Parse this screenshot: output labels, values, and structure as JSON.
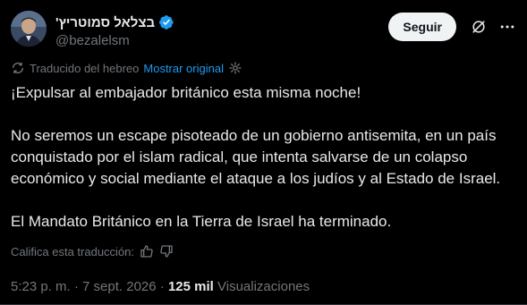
{
  "author": {
    "display_name": "בצלאל סמוטריץ'",
    "handle": "@bezalelsm",
    "verified": true
  },
  "actions": {
    "follow_label": "Seguir",
    "grok_icon": "grok-icon",
    "more_icon": "more-horizontal-icon"
  },
  "translation": {
    "note": "Traducido del hebreo",
    "show_original": "Mostrar original",
    "settings_icon": "gear-icon",
    "rate_label": "Califica esta traducción:"
  },
  "post": {
    "paragraphs": [
      "¡Expulsar al embajador británico esta misma noche!",
      "No seremos un escape pisoteado de un gobierno antisemita, en un país conquistado por el islam radical, que intenta salvarse de un colapso económico y social mediante el ataque a los judíos y al Estado de Israel.",
      "El Mandato Británico en la Tierra de Israel ha terminado."
    ]
  },
  "meta": {
    "time": "5:23 p. m.",
    "separator": "·",
    "date": "7 sept. 2026",
    "views_count": "125 mil",
    "views_label": "Visualizaciones"
  },
  "colors": {
    "background": "#000000",
    "text_primary": "#e7e9ea",
    "text_secondary": "#71767b",
    "accent": "#1d9bf0",
    "follow_bg": "#eff3f4"
  }
}
